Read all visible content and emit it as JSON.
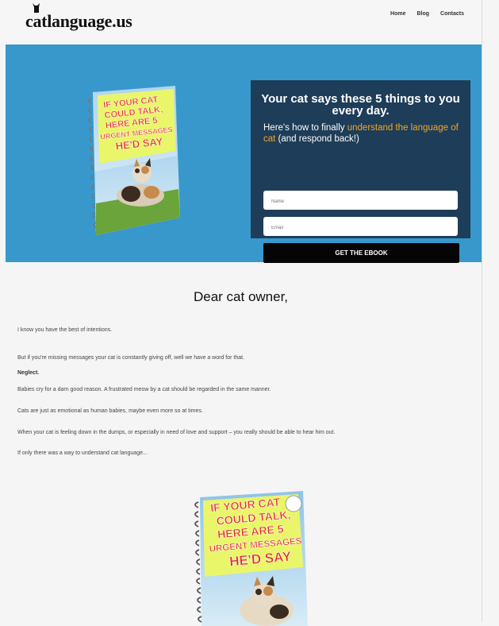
{
  "header": {
    "logo": "catlanguage.us",
    "nav": [
      "Home",
      "Blog",
      "Contacts"
    ]
  },
  "hero": {
    "book_cover_text": [
      "IF YOUR CAT",
      "COULD TALK,",
      "HERE ARE 5",
      "URGENT MESSAGES",
      "HE'D SAY"
    ],
    "optin": {
      "headline": "Your cat says these 5 things to you every day.",
      "sub_before": "Here's how to finally ",
      "sub_highlight": "understand the language of cat",
      "sub_after": " (and respond back!)",
      "name_placeholder": "Name",
      "email_placeholder": "Email",
      "button_label": "GET THE EBOOK"
    }
  },
  "content": {
    "title": "Dear cat owner,",
    "paragraphs": [
      "I know you have the best of intentions.",
      "But if you're missing messages your cat is constantly giving off, well we have a word for that.",
      "Neglect.",
      "Babies cry for a darn good reason. A frustrated meow by a cat should be regarded in the same manner.",
      "Cats are just as emotional as human babies, maybe even more so at times.",
      "When your cat is feeling down in the dumps, or especially in need of love and support – you really should be able to hear him out.",
      "If only there was a way to understand cat language..."
    ]
  },
  "colors": {
    "hero_bg": "#3898cc",
    "optin_bg": "#1e3d58",
    "highlight": "#f5a623",
    "button_bg": "#050505"
  }
}
